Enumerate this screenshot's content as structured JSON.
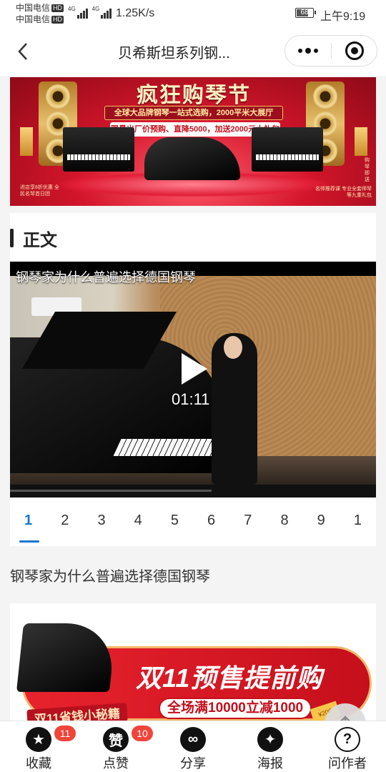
{
  "status_bar": {
    "carrier_1": "中国电信",
    "carrier_2": "中国电信",
    "hd_badge": "HD",
    "network_type": "4G",
    "net_speed": "1.25K/s",
    "battery": "68",
    "time": "上午9:19"
  },
  "nav": {
    "title": "贝希斯坦系列钢...",
    "back_icon": "chevron-left-icon",
    "more_icon": "more-dots-icon",
    "close_icon": "target-close-icon"
  },
  "banner": {
    "headline": "疯狂购琴节",
    "line_1": "全球大品牌钢琴一站式选购，2000平米大展厅",
    "line_2": "限量出厂价预购、直降5000，加送2000元大礼包",
    "side_left": "进店享8折优惠 全民名琴首日团",
    "side_right": "名师推荐课 专业全套师琴等九重礼包",
    "side_vertical": "购琴即送",
    "colors": {
      "primary": "#d3152b",
      "gold": "#f3c261"
    }
  },
  "section": {
    "label": "正文"
  },
  "video": {
    "title": "钢琴家为什么普遍选择德国钢琴",
    "duration": "01:11",
    "play_icon": "play-icon",
    "progress": 0.55
  },
  "pager": {
    "pages": [
      "1",
      "2",
      "3",
      "4",
      "5",
      "6",
      "7",
      "8",
      "9",
      "1"
    ],
    "active_index": 0,
    "active_color": "#1677d2"
  },
  "article": {
    "title": "钢琴家为什么普遍选择德国钢琴"
  },
  "promo": {
    "main_text": "双11预售提前购",
    "sub_text": "全场满10000立减1000",
    "tag_text": "双11省钱小秘籍",
    "coupon_text": "¥200"
  },
  "scroll_top_icon": "arrow-up-icon",
  "toolbar": {
    "items": [
      {
        "label": "收藏",
        "icon": "star-icon",
        "glyph": "★",
        "badge": "11"
      },
      {
        "label": "点赞",
        "icon": "like-icon",
        "glyph": "赞",
        "badge": "10"
      },
      {
        "label": "分享",
        "icon": "share-icon",
        "glyph": "∞"
      },
      {
        "label": "海报",
        "icon": "poster-icon",
        "glyph": "✦"
      },
      {
        "label": "问作者",
        "icon": "question-icon",
        "glyph": "?"
      }
    ]
  }
}
